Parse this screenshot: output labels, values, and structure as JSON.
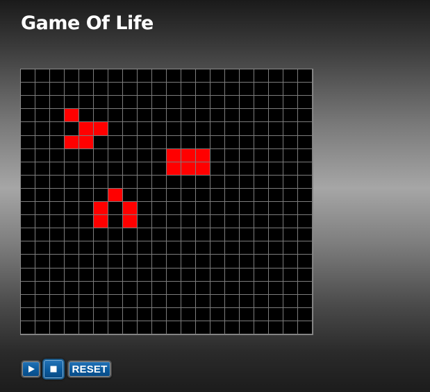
{
  "title": "Game Of Life",
  "board": {
    "cols": 20,
    "rows": 20,
    "alive_cells": [
      [
        3,
        3
      ],
      [
        4,
        4
      ],
      [
        4,
        5
      ],
      [
        5,
        3
      ],
      [
        5,
        4
      ],
      [
        6,
        10
      ],
      [
        6,
        11
      ],
      [
        6,
        12
      ],
      [
        7,
        10
      ],
      [
        7,
        11
      ],
      [
        7,
        12
      ],
      [
        9,
        6
      ],
      [
        10,
        5
      ],
      [
        10,
        7
      ],
      [
        11,
        5
      ],
      [
        11,
        7
      ]
    ],
    "alive_color": "#ff0000",
    "dead_color": "#000000",
    "grid_line_color": "#7d7d7d"
  },
  "controls": {
    "play_icon": "play-icon",
    "stop_icon": "stop-icon",
    "reset_label": "RESET",
    "button_color": "#0b5a9c"
  }
}
